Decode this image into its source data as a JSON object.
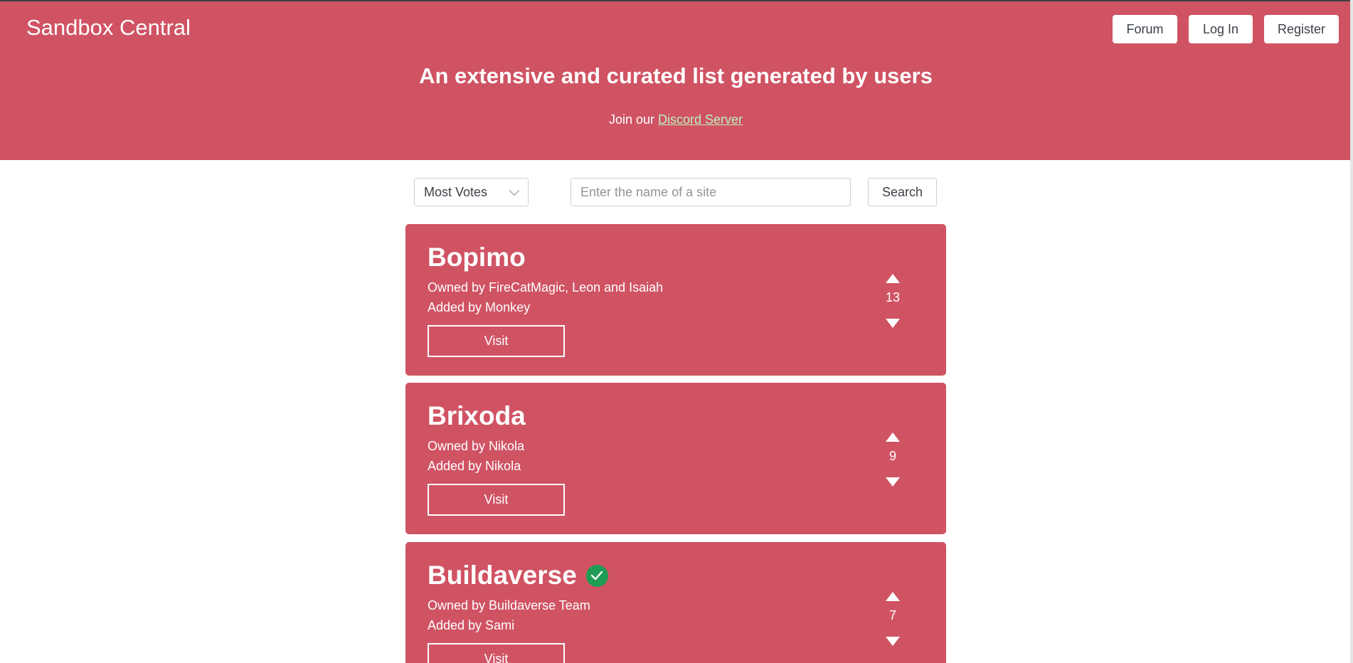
{
  "header": {
    "brand": "Sandbox Central",
    "nav": {
      "forum": "Forum",
      "login": "Log In",
      "register": "Register"
    },
    "tagline": "An extensive and curated list generated by users",
    "join_prefix": "Join our",
    "join_link": "Discord Server"
  },
  "controls": {
    "sort_selected": "Most Votes",
    "search_placeholder": "Enter the name of a site",
    "search_button": "Search"
  },
  "sites": [
    {
      "name": "Bopimo",
      "owned": "Owned by FireCatMagic, Leon and Isaiah",
      "added": "Added by Monkey",
      "visit": "Visit",
      "votes": "13",
      "verified": false
    },
    {
      "name": "Brixoda",
      "owned": "Owned by Nikola",
      "added": "Added by Nikola",
      "visit": "Visit",
      "votes": "9",
      "verified": false
    },
    {
      "name": "Buildaverse",
      "owned": "Owned by Buildaverse Team",
      "added": "Added by Sami",
      "visit": "Visit",
      "votes": "7",
      "verified": true
    }
  ],
  "colors": {
    "brand": "#d05363",
    "link": "#b9f3c0",
    "verified": "#1f9d55"
  },
  "icons": {
    "upvote": "triangle-up",
    "downvote": "triangle-down",
    "verified": "check-circle",
    "select": "chevron-down"
  }
}
